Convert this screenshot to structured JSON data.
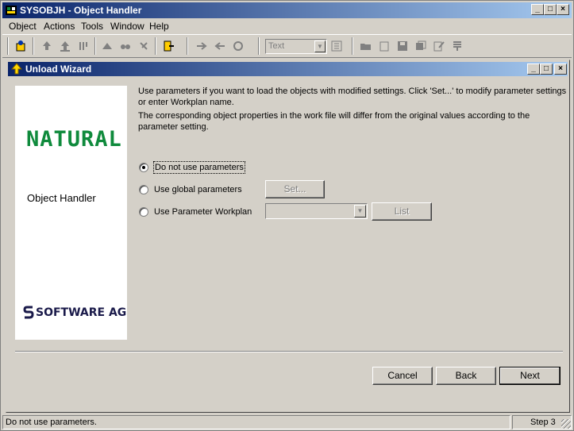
{
  "window": {
    "title": "SYSOBJH - Object Handler"
  },
  "menu": [
    {
      "label": "Object",
      "underline": "O"
    },
    {
      "label": "Actions",
      "underline": "A"
    },
    {
      "label": "Tools",
      "underline": "T"
    },
    {
      "label": "Window",
      "underline": "W"
    },
    {
      "label": "Help",
      "underline": "H"
    }
  ],
  "toolbar": {
    "combo_value": "Text"
  },
  "wizard": {
    "title": "Unload Wizard",
    "description_1": "Use parameters if you want to load the objects with modified settings. Click 'Set...' to modify parameter settings or enter Workplan name.",
    "description_2": "The corresponding object properties in the work file will differ from the original values according to the parameter setting.",
    "panel": {
      "product_logo": "NATURAL",
      "product_name": "Object Handler",
      "vendor_logo": "SOFTWARE AG"
    },
    "options": [
      {
        "label": "Do not use parameters",
        "checked": true
      },
      {
        "label": "Use global parameters",
        "checked": false
      },
      {
        "label": "Use Parameter Workplan",
        "checked": false
      }
    ],
    "set_button": "Set...",
    "list_button": "List",
    "cancel_button": "Cancel",
    "back_button": "Back",
    "next_button": "Next"
  },
  "status": {
    "message": "Do not use parameters.",
    "step": "Step 3"
  },
  "colors": {
    "title_start": "#0a246a",
    "title_end": "#a6caf0",
    "natural_green": "#0f8a3c"
  }
}
